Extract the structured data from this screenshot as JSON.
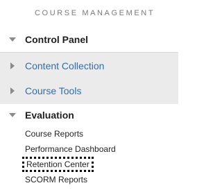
{
  "section": {
    "title": "COURSE MANAGEMENT"
  },
  "menu": {
    "items": [
      {
        "label": "Control Panel",
        "state": "expanded",
        "icon": "caret-down-icon"
      },
      {
        "label": "Content Collection",
        "state": "collapsed",
        "icon": "caret-right-icon"
      },
      {
        "label": "Course Tools",
        "state": "collapsed",
        "icon": "caret-right-icon"
      },
      {
        "label": "Evaluation",
        "state": "expanded",
        "icon": "caret-down-icon"
      }
    ],
    "evaluation_items": [
      {
        "label": "Course Reports"
      },
      {
        "label": "Performance Dashboard"
      },
      {
        "label": "Retention Center",
        "focused": true
      },
      {
        "label": "SCORM Reports"
      }
    ]
  },
  "colors": {
    "link": "#2b6fb5",
    "row_shade": "#ebebeb",
    "header_text": "#7a7a7a",
    "caret": "#8a8a8a"
  }
}
